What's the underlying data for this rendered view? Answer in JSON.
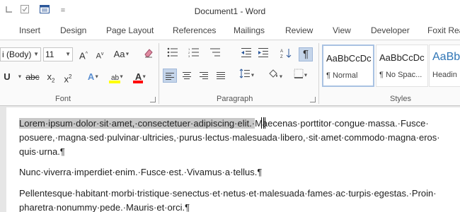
{
  "window": {
    "title": "Document1 - Word"
  },
  "qat": {
    "menu_glyph": "="
  },
  "tabs": [
    "Insert",
    "Design",
    "Page Layout",
    "References",
    "Mailings",
    "Review",
    "View",
    "Developer",
    "Foxit Rea"
  ],
  "font": {
    "name": "i (Body)",
    "size": "11",
    "group_label": "Font",
    "grow": "A",
    "shrink": "A",
    "change_case": "Aa",
    "strike": "abc",
    "subscript": "x",
    "superscript": "x",
    "effects": "A",
    "highlight": "ab",
    "font_color": "A",
    "highlight_color": "#ffff00",
    "font_color_value": "#ff0000"
  },
  "paragraph": {
    "group_label": "Paragraph",
    "show_marks": "¶"
  },
  "styles": {
    "group_label": "Styles",
    "items": [
      {
        "sample": "AaBbCcDc",
        "name": "¶ Normal"
      },
      {
        "sample": "AaBbCcDc",
        "name": "¶ No Spac..."
      },
      {
        "sample": "AaBb",
        "name": "Headin"
      }
    ]
  },
  "document": {
    "para1_selected": "Lorem·ipsum·dolor·sit·amet,·consectetuer·adipiscing·elit.·",
    "para1_rest": "Maecenas·porttitor·congue·massa.·Fusce·",
    "para1_line2": "posuere,·magna·sed·pulvinar·ultricies,·purus·lectus·malesuada·libero,·sit·amet·commodo·magna·eros·",
    "para1_line3": "quis·urna.¶",
    "para2": "Nunc·viverra·imperdiet·enim.·Fusce·est.·Vivamus·a·tellus.¶",
    "para3_line1": "Pellentesque·habitant·morbi·tristique·senectus·et·netus·et·malesuada·fames·ac·turpis·egestas.·Proin·",
    "para3_line2": "pharetra·nonummy·pede.·Mauris·et·orci.¶"
  }
}
